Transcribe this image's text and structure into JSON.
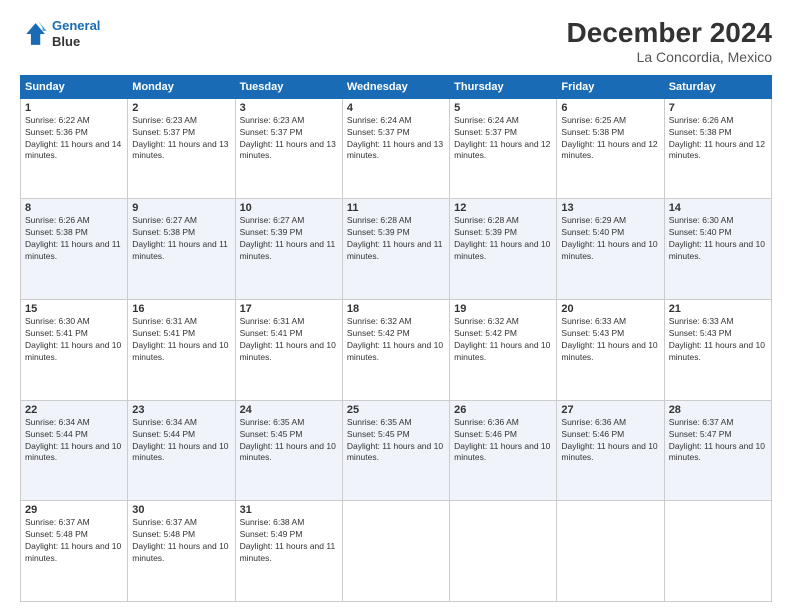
{
  "header": {
    "logo_line1": "General",
    "logo_line2": "Blue",
    "title": "December 2024",
    "subtitle": "La Concordia, Mexico"
  },
  "days_of_week": [
    "Sunday",
    "Monday",
    "Tuesday",
    "Wednesday",
    "Thursday",
    "Friday",
    "Saturday"
  ],
  "weeks": [
    [
      {
        "day": "1",
        "sunrise": "6:22 AM",
        "sunset": "5:36 PM",
        "daylight": "11 hours and 14 minutes."
      },
      {
        "day": "2",
        "sunrise": "6:23 AM",
        "sunset": "5:37 PM",
        "daylight": "11 hours and 13 minutes."
      },
      {
        "day": "3",
        "sunrise": "6:23 AM",
        "sunset": "5:37 PM",
        "daylight": "11 hours and 13 minutes."
      },
      {
        "day": "4",
        "sunrise": "6:24 AM",
        "sunset": "5:37 PM",
        "daylight": "11 hours and 13 minutes."
      },
      {
        "day": "5",
        "sunrise": "6:24 AM",
        "sunset": "5:37 PM",
        "daylight": "11 hours and 12 minutes."
      },
      {
        "day": "6",
        "sunrise": "6:25 AM",
        "sunset": "5:38 PM",
        "daylight": "11 hours and 12 minutes."
      },
      {
        "day": "7",
        "sunrise": "6:26 AM",
        "sunset": "5:38 PM",
        "daylight": "11 hours and 12 minutes."
      }
    ],
    [
      {
        "day": "8",
        "sunrise": "6:26 AM",
        "sunset": "5:38 PM",
        "daylight": "11 hours and 11 minutes."
      },
      {
        "day": "9",
        "sunrise": "6:27 AM",
        "sunset": "5:38 PM",
        "daylight": "11 hours and 11 minutes."
      },
      {
        "day": "10",
        "sunrise": "6:27 AM",
        "sunset": "5:39 PM",
        "daylight": "11 hours and 11 minutes."
      },
      {
        "day": "11",
        "sunrise": "6:28 AM",
        "sunset": "5:39 PM",
        "daylight": "11 hours and 11 minutes."
      },
      {
        "day": "12",
        "sunrise": "6:28 AM",
        "sunset": "5:39 PM",
        "daylight": "11 hours and 10 minutes."
      },
      {
        "day": "13",
        "sunrise": "6:29 AM",
        "sunset": "5:40 PM",
        "daylight": "11 hours and 10 minutes."
      },
      {
        "day": "14",
        "sunrise": "6:30 AM",
        "sunset": "5:40 PM",
        "daylight": "11 hours and 10 minutes."
      }
    ],
    [
      {
        "day": "15",
        "sunrise": "6:30 AM",
        "sunset": "5:41 PM",
        "daylight": "11 hours and 10 minutes."
      },
      {
        "day": "16",
        "sunrise": "6:31 AM",
        "sunset": "5:41 PM",
        "daylight": "11 hours and 10 minutes."
      },
      {
        "day": "17",
        "sunrise": "6:31 AM",
        "sunset": "5:41 PM",
        "daylight": "11 hours and 10 minutes."
      },
      {
        "day": "18",
        "sunrise": "6:32 AM",
        "sunset": "5:42 PM",
        "daylight": "11 hours and 10 minutes."
      },
      {
        "day": "19",
        "sunrise": "6:32 AM",
        "sunset": "5:42 PM",
        "daylight": "11 hours and 10 minutes."
      },
      {
        "day": "20",
        "sunrise": "6:33 AM",
        "sunset": "5:43 PM",
        "daylight": "11 hours and 10 minutes."
      },
      {
        "day": "21",
        "sunrise": "6:33 AM",
        "sunset": "5:43 PM",
        "daylight": "11 hours and 10 minutes."
      }
    ],
    [
      {
        "day": "22",
        "sunrise": "6:34 AM",
        "sunset": "5:44 PM",
        "daylight": "11 hours and 10 minutes."
      },
      {
        "day": "23",
        "sunrise": "6:34 AM",
        "sunset": "5:44 PM",
        "daylight": "11 hours and 10 minutes."
      },
      {
        "day": "24",
        "sunrise": "6:35 AM",
        "sunset": "5:45 PM",
        "daylight": "11 hours and 10 minutes."
      },
      {
        "day": "25",
        "sunrise": "6:35 AM",
        "sunset": "5:45 PM",
        "daylight": "11 hours and 10 minutes."
      },
      {
        "day": "26",
        "sunrise": "6:36 AM",
        "sunset": "5:46 PM",
        "daylight": "11 hours and 10 minutes."
      },
      {
        "day": "27",
        "sunrise": "6:36 AM",
        "sunset": "5:46 PM",
        "daylight": "11 hours and 10 minutes."
      },
      {
        "day": "28",
        "sunrise": "6:37 AM",
        "sunset": "5:47 PM",
        "daylight": "11 hours and 10 minutes."
      }
    ],
    [
      {
        "day": "29",
        "sunrise": "6:37 AM",
        "sunset": "5:48 PM",
        "daylight": "11 hours and 10 minutes."
      },
      {
        "day": "30",
        "sunrise": "6:37 AM",
        "sunset": "5:48 PM",
        "daylight": "11 hours and 10 minutes."
      },
      {
        "day": "31",
        "sunrise": "6:38 AM",
        "sunset": "5:49 PM",
        "daylight": "11 hours and 11 minutes."
      },
      null,
      null,
      null,
      null
    ]
  ]
}
